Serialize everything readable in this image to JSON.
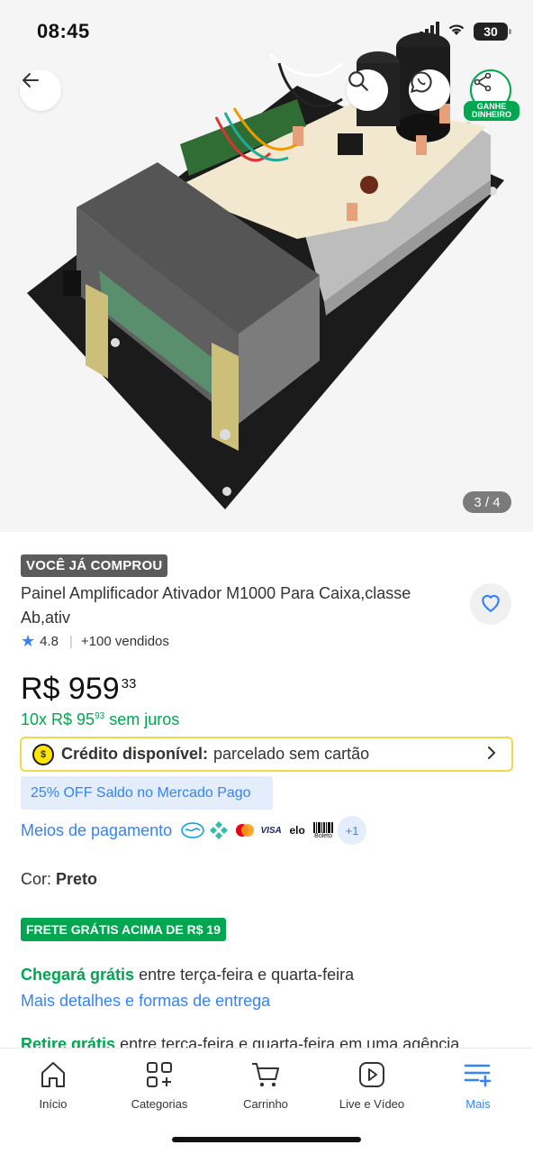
{
  "status_bar": {
    "time": "08:45",
    "battery": "30"
  },
  "gallery": {
    "counter": "3 / 4",
    "earn_badge_line1": "GANHE",
    "earn_badge_line2": "DINHEIRO"
  },
  "product": {
    "bought_tag": "VOCÊ JÁ COMPROU",
    "title": "Painel Amplificador Ativador M1000 Para Caixa,classe Ab,ativ",
    "rating": "4.8",
    "sold": "+100 vendidos",
    "price_currency": "R$",
    "price_int": "959",
    "price_cents": "33",
    "installments_prefix": "10x R$ 95",
    "installments_cents": "93",
    "installments_suffix": "sem juros"
  },
  "credit": {
    "label": "Crédito disponível:",
    "text": "parcelado sem cartão",
    "coin": "$"
  },
  "discount": {
    "text": "25% OFF Saldo no Mercado Pago"
  },
  "payment": {
    "link": "Meios de pagamento",
    "more": "+1",
    "visa": "VISA",
    "elo": "elo",
    "boleto": "Boleto"
  },
  "color": {
    "label": "Cor:",
    "value": "Preto"
  },
  "shipping": {
    "free_tag": "FRETE GRÁTIS ACIMA DE R$ 19",
    "arrival_green": "Chegará grátis",
    "arrival_text": "entre terça-feira e quarta-feira",
    "details_link": "Mais detalhes e formas de entrega",
    "pickup_green": "Retire grátis",
    "pickup_text": "entre terça-feira e quarta-feira em uma agência"
  },
  "bottom_nav": {
    "items": [
      {
        "label": "Início",
        "icon": "home-icon"
      },
      {
        "label": "Categorias",
        "icon": "categories-icon"
      },
      {
        "label": "Carrinho",
        "icon": "cart-icon"
      },
      {
        "label": "Live e Vídeo",
        "icon": "play-icon"
      },
      {
        "label": "Mais",
        "icon": "menu-plus-icon"
      }
    ],
    "active_color": "#3483fa"
  },
  "colors": {
    "brand_blue": "#3483fa",
    "green": "#00a650",
    "yellow": "#ffe600"
  }
}
